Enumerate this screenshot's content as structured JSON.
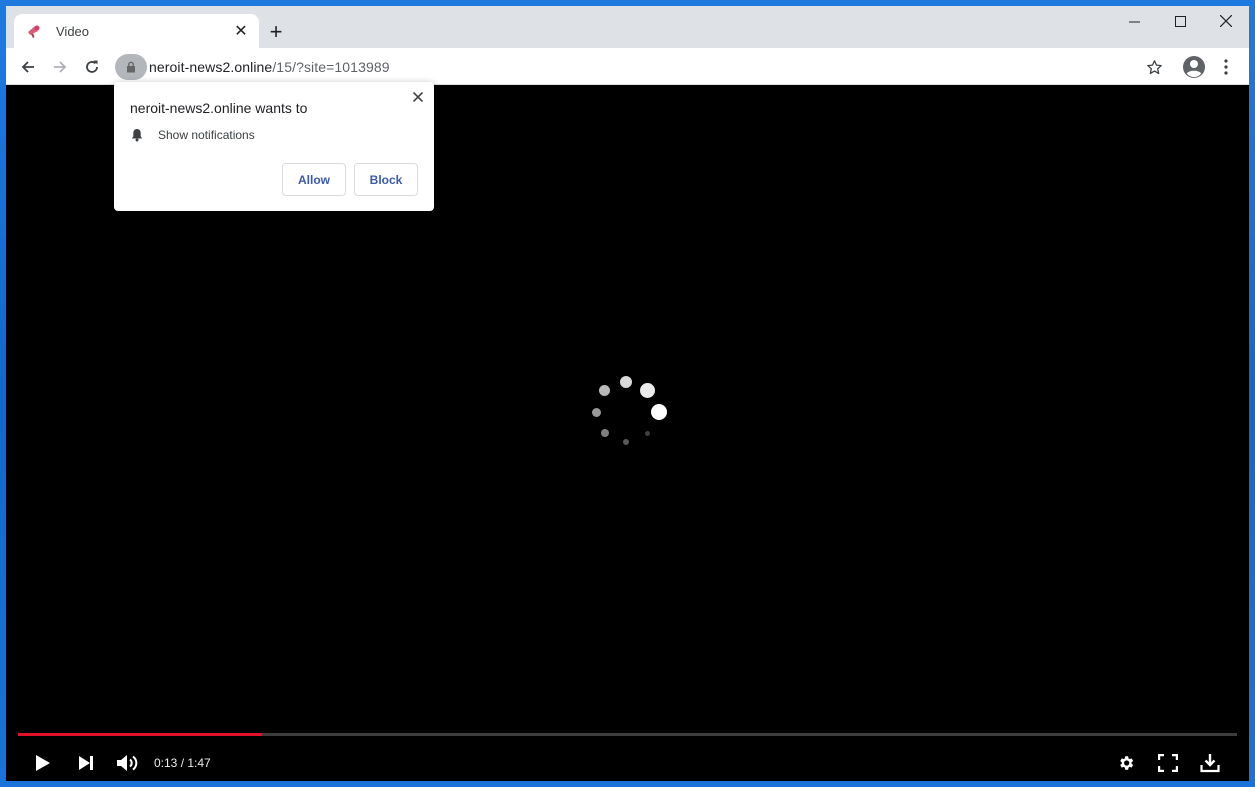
{
  "browser": {
    "tab": {
      "title": "Video",
      "favicon": "megaphone-icon"
    },
    "new_tab_symbol": "+",
    "tab_close_symbol": "✕",
    "address": {
      "host": "neroit-news2.online",
      "path": "/15/?site=1013989"
    }
  },
  "popup": {
    "title": "neroit-news2.online wants to",
    "permission": "Show notifications",
    "allow_label": "Allow",
    "block_label": "Block"
  },
  "video": {
    "time_display": "0:13 / 1:47",
    "progress_fraction": 0.2,
    "loading": true
  },
  "colors": {
    "progress": "#e3102a",
    "desktop": "#1a6fd0",
    "button_text": "#3b5ba9"
  }
}
